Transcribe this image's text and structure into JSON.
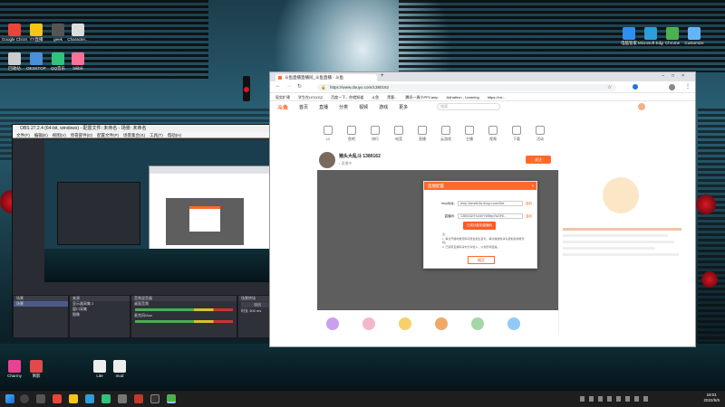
{
  "colors": {
    "brand_orange": "#ff6a2a",
    "obs_bg": "#2a2c33",
    "taskbar": "#1e1e1e"
  },
  "desktop_icons": [
    {
      "label": "Google Chrome",
      "icon": "chrome-icon",
      "color": "#e8453c"
    },
    {
      "label": "YY直播",
      "icon": "yy-icon",
      "color": "#f5c518"
    },
    {
      "label": "geek",
      "icon": "app-icon",
      "color": "#555555"
    },
    {
      "label": "Character...",
      "icon": "file-icon",
      "color": "#dddddd"
    },
    {
      "label": "回收站",
      "icon": "recycle-bin-icon",
      "color": "#cccccc"
    },
    {
      "label": "DESKTOP",
      "icon": "file-icon",
      "color": "#4a90d9"
    },
    {
      "label": "QQ音乐",
      "icon": "qqmusic-icon",
      "color": "#31c27c"
    },
    {
      "label": "bilibili",
      "icon": "app-icon",
      "color": "#fb7299"
    },
    {
      "label": "Charmy",
      "icon": "app-icon",
      "color": "#e84393"
    },
    {
      "label": "简影",
      "icon": "app-icon",
      "color": "#e24a4a"
    },
    {
      "label": "Lite",
      "icon": "file-icon",
      "color": "#eeeeee"
    },
    {
      "label": "mod",
      "icon": "file-icon",
      "color": "#eeeeee"
    },
    {
      "label": "电脑管家",
      "icon": "app-icon",
      "color": "#2f8ff0"
    },
    {
      "label": "Microsoft Edge",
      "icon": "edge-icon",
      "color": "#2e9dd8"
    },
    {
      "label": "Chrome",
      "icon": "chrome-icon",
      "color": "#4caf50"
    },
    {
      "label": "Customize",
      "icon": "app-icon",
      "color": "#64b5f6"
    }
  ],
  "obs": {
    "title": "OBS 27.2.4 (64-bit, windows) - 配置文件: 未命名 - 场景: 未命名",
    "menu": [
      "文件(F)",
      "编辑(E)",
      "视图(V)",
      "停靠部件(D)",
      "配置文件(P)",
      "场景集合(S)",
      "工具(T)",
      "帮助(H)"
    ],
    "docks": {
      "scenes_header": "场景",
      "scenes": [
        "场景"
      ],
      "sources_header": "来源",
      "sources": [
        "显示器采集 2",
        "窗口采集",
        "图像"
      ],
      "mixer_header": "音频混音器",
      "mixer": [
        "桌面音频",
        "麦克风/Aux"
      ],
      "transitions_header": "场景转场",
      "transition_value": "淡出",
      "duration_label": "时长",
      "duration_value": "300 ms",
      "controls_header": "控件",
      "controls": [
        "停止推流",
        "开始录制",
        "启动虚拟摄像机",
        "工作室模式",
        "设置",
        "退出"
      ]
    }
  },
  "browser": {
    "tab_title": "斗鱼直播直播间_斗鱼直播 - 斗鱼",
    "url": "https://www.douyu.com/1380162",
    "bookmarks": [
      "现实扩建",
      "学生在LEGO以",
      "百度一下，你就知道",
      "斗鱼",
      "黑客...",
      "腾讯一周小PPCamp",
      "Adhathon - Learning",
      "https://xn..."
    ],
    "site_logo": "斗鱼",
    "site_nav": [
      "首页",
      "直播",
      "分类",
      "视频",
      "游戏",
      "更多"
    ],
    "search_placeholder": "搜索",
    "categories": [
      "12",
      "鱼吧",
      "排行",
      "电竞",
      "直播",
      "云游戏",
      "主播",
      "视频",
      "下载",
      "活动"
    ],
    "room_name": "猪头大乱斗 1380162",
    "room_status": "• 直播中",
    "follow_label": "关注"
  },
  "dialog": {
    "title": "直播配置",
    "close": "×",
    "fields": [
      {
        "label": "rtmp地址:",
        "value": "rtmp://sendtc3a.douyu.com/live",
        "copy": "复制"
      },
      {
        "label": "直播码:",
        "value": "1380162rTh2dXYW8ep7wOF6...",
        "copy": "复制"
      }
    ],
    "tooltip": "已成功复制直播码",
    "notes": "注：\n1. 每次开播时推流码可能会发生变化，每次播放前请先复制最新推流码。\n2. 已使用直播码请勿分享他人，以免影响直播。",
    "ok_label": "确定"
  },
  "taskbar": {
    "time": "18:01",
    "date": "2022/5/5"
  }
}
